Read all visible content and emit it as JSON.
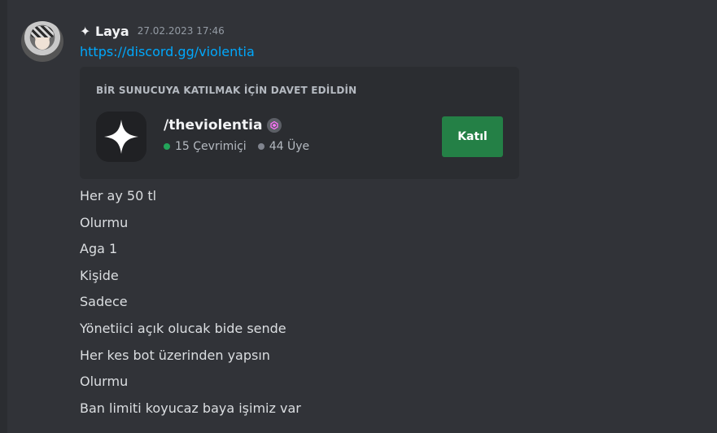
{
  "message": {
    "author": "✦ Laya",
    "timestamp": "27.02.2023 17:46",
    "link": "https://discord.gg/violentia"
  },
  "invite": {
    "heading": "BİR SUNUCUYA KATILMAK İÇİN DAVET EDİLDİN",
    "server_name": "/theviolentia",
    "online_text": "15 Çevrimiçi",
    "members_text": "44 Üye",
    "join_label": "Katıl",
    "icon": "sparkle-icon",
    "badge_icon": "server-boost-badge-icon"
  },
  "lines": [
    "Her ay 50 tl",
    "Olurmu",
    "Aga 1",
    "Kişide",
    "Sadece",
    "Yönetiici açık olucak bide sende",
    "Her kes bot üzerinden yapsın",
    "Olurmu",
    "Ban limiti koyucaz baya işimiz var"
  ],
  "colors": {
    "background": "#313338",
    "embed": "#2b2d31",
    "link": "#00a8fc",
    "join_button": "#248046",
    "online": "#23a55a"
  }
}
